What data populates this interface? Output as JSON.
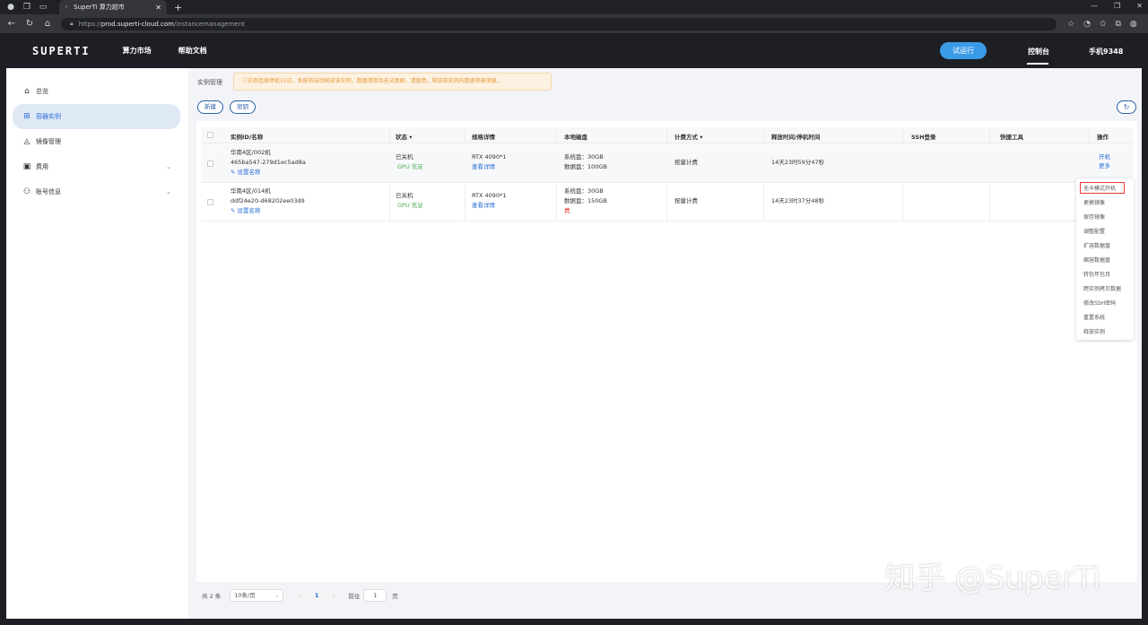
{
  "browser": {
    "tab_title": "SuperTi 算力超市",
    "url_scheme": "https://",
    "url_host": "prod.superti-cloud.com",
    "url_path": "/instancemanagement",
    "icons": [
      "back-icon",
      "forward-icon",
      "reload-icon",
      "home-icon",
      "lock-icon",
      "star-icon",
      "extensions-icon",
      "profile-icon"
    ]
  },
  "header": {
    "logo": "SUPERTI",
    "nav": [
      "算力市场",
      "帮助文档"
    ],
    "try_button": "试运行",
    "console": "控制台",
    "user": "手机9348"
  },
  "sidebar": {
    "items": [
      {
        "label": "总览",
        "icon": "home-icon"
      },
      {
        "label": "容器实例",
        "icon": "grid-icon",
        "active": true
      },
      {
        "label": "镜像管理",
        "icon": "layers-icon"
      },
      {
        "label": "费用",
        "icon": "bill-icon",
        "expandable": true
      },
      {
        "label": "账号信息",
        "icon": "user-icon",
        "expandable": true
      }
    ]
  },
  "main": {
    "breadcrumb": "实例管理",
    "notice": "ⓘ实例连续停机15日，系统将自动释放该实例，数据清除且无法复原，请留意。释放前实例内数据将被保留。",
    "new_button": "新建",
    "key_button": "密钥",
    "columns": [
      "实例ID/名称",
      "状态",
      "规格详情",
      "本地磁盘",
      "计费方式",
      "释放时间/停机时间",
      "SSH登录",
      "快捷工具",
      "操作"
    ],
    "status_sort_icon": "▾",
    "billing_sort_icon": "▾",
    "rows": [
      {
        "region": "华南4区/002机",
        "id": "465ba547-279d1ec5ad8a",
        "rename": "设置名称",
        "status": "已关机",
        "gpu": "GPU 充足",
        "spec": "RTX 4090*1",
        "spec_link": "查看详情",
        "disk_sys": "系统盘：30GB",
        "disk_data": "数据盘：100GB",
        "disk_fee": "",
        "billing": "按量计费",
        "release": "14天23时59分47秒",
        "actions": [
          "开机",
          "更多"
        ]
      },
      {
        "region": "华南4区/014机",
        "id": "ddf24e20-d68202ee03d9",
        "rename": "设置名称",
        "status": "已关机",
        "gpu": "GPU 充足",
        "spec": "RTX 4090*1",
        "spec_link": "查看详情",
        "disk_sys": "系统盘：30GB",
        "disk_data": "数据盘：150GB",
        "disk_fee": "费",
        "billing": "按量计费",
        "release": "14天23时37分48秒",
        "actions": []
      }
    ],
    "more_menu": [
      "无卡模式开机",
      "更换镜像",
      "保存镜像",
      "调整配置",
      "扩容数据盘",
      "缩容数据盘",
      "转包年包月",
      "跨实例拷贝数据",
      "修改SSH密码",
      "重置系统",
      "释放实例"
    ],
    "pagination": {
      "total": "共 2 条",
      "page_size": "10条/页",
      "current": "1",
      "goto_label": "前往",
      "goto_value": "1",
      "page_unit": "页"
    }
  },
  "watermark": "知乎 @SuperTi",
  "colors": {
    "accent": "#2a6fd6",
    "header_bg": "#1d1f24",
    "try_button": "#3a9be6",
    "notice": "#e79a33",
    "gpu_ok": "#4caf50",
    "highlight": "#e53935"
  }
}
